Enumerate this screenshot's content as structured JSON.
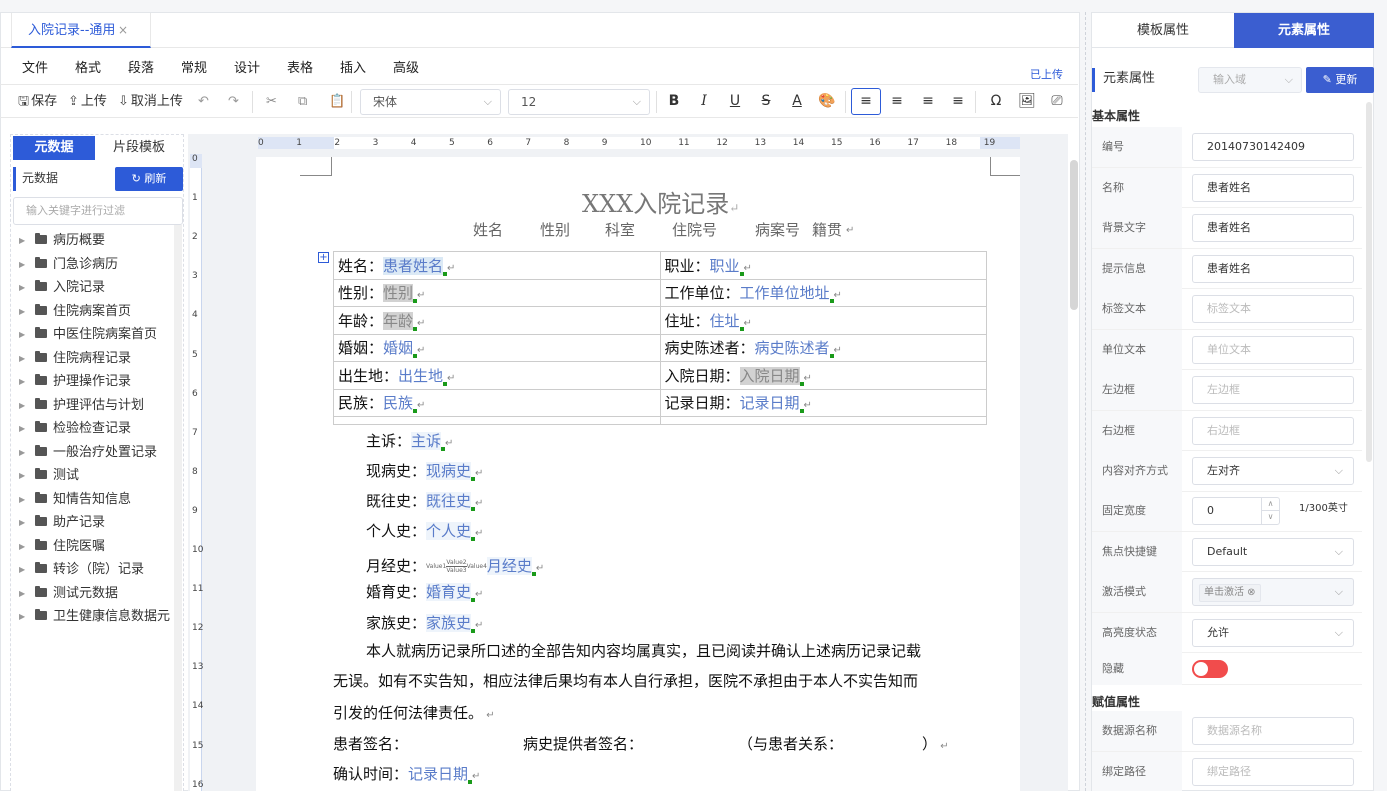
{
  "doc_tab": {
    "title": "入院记录--通用",
    "close": "×"
  },
  "menu": [
    "文件",
    "格式",
    "段落",
    "常规",
    "设计",
    "表格",
    "插入",
    "高级"
  ],
  "upload_status": "已上传",
  "toolbar": {
    "save": "保存",
    "upload": "上传",
    "cancel_upload": "取消上传",
    "font_family": "宋体",
    "font_size": "12"
  },
  "left_panel": {
    "tab_metadata": "元数据",
    "tab_fragment": "片段模板",
    "title": "元数据",
    "refresh": "刷新",
    "search_placeholder": "输入关键字进行过滤",
    "tree": [
      "病历概要",
      "门急诊病历",
      "入院记录",
      "住院病案首页",
      "中医住院病案首页",
      "住院病程记录",
      "护理操作记录",
      "护理评估与计划",
      "检验检查记录",
      "一般治疗处置记录",
      "测试",
      "知情告知信息",
      "助产记录",
      "住院医嘱",
      "转诊（院）记录",
      "测试元数据",
      "卫生健康信息数据元"
    ]
  },
  "ruler": {
    "h": [
      "0",
      "1",
      "2",
      "3",
      "4",
      "5",
      "6",
      "7",
      "8",
      "9",
      "10",
      "11",
      "12",
      "13",
      "14",
      "15",
      "16",
      "17",
      "18",
      "19"
    ],
    "v": [
      "0",
      "1",
      "2",
      "3",
      "4",
      "5",
      "6",
      "7",
      "8",
      "9",
      "10",
      "11",
      "12",
      "13",
      "14",
      "15",
      "16"
    ]
  },
  "document": {
    "title": "XXX入院记录",
    "subtitle": [
      "姓名",
      "性别",
      "科室",
      "住院号",
      "病案号",
      "籍贯"
    ],
    "table": [
      [
        {
          "label": "姓名：",
          "value": "患者姓名"
        },
        {
          "label": "职业：",
          "value": "职业"
        }
      ],
      [
        {
          "label": "性别：",
          "value": "性别"
        },
        {
          "label": "工作单位：",
          "value": "工作单位地址"
        }
      ],
      [
        {
          "label": "年龄：",
          "value": "年龄"
        },
        {
          "label": "住址：",
          "value": "住址"
        }
      ],
      [
        {
          "label": "婚姻：",
          "value": "婚姻"
        },
        {
          "label": "病史陈述者：",
          "value": "病史陈述者"
        }
      ],
      [
        {
          "label": "出生地：",
          "value": "出生地"
        },
        {
          "label": "入院日期：",
          "value": "入院日期"
        }
      ],
      [
        {
          "label": "民族：",
          "value": "民族"
        },
        {
          "label": "记录日期：",
          "value": "记录日期"
        }
      ]
    ],
    "lines": [
      {
        "label": "主诉：",
        "value": "主诉"
      },
      {
        "label": "现病史：",
        "value": "现病史"
      },
      {
        "label": "既往史：",
        "value": "既往史"
      },
      {
        "label": "个人史：",
        "value": "个人史"
      },
      {
        "label": "月经史：",
        "value": "月经史"
      },
      {
        "label": "婚育史：",
        "value": "婚育史"
      },
      {
        "label": "家族史：",
        "value": "家族史"
      }
    ],
    "menstrual_formula": {
      "left": "Value1",
      "top": "Value2",
      "bottom": "Value3",
      "right": "Value4"
    },
    "statement_1": "本人就病历记录所口述的全部告知内容均属真实，且已阅读并确认上述病历记录记载",
    "statement_2": "无误。如有不实告知，相应法律后果均有本人自行承担，医院不承担由于本人不实告知而",
    "statement_3": "引发的任何法律责任。",
    "sign_patient": "患者签名：",
    "sign_provider": "病史提供者签名：",
    "sign_relation": "（与患者关系：",
    "sign_relation_close": "）",
    "confirm_label": "确认时间：",
    "confirm_value": "记录日期"
  },
  "right_panel": {
    "tab_template": "模板属性",
    "tab_element": "元素属性",
    "title": "元素属性",
    "select_placeholder": "输入域",
    "update": "更新",
    "section_basic": "基本属性",
    "props": [
      {
        "label": "编号",
        "value": "20140730142409",
        "ph": false
      },
      {
        "label": "名称",
        "value": "患者姓名",
        "ph": false
      },
      {
        "label": "背景文字",
        "value": "患者姓名",
        "ph": false
      },
      {
        "label": "提示信息",
        "value": "患者姓名",
        "ph": false
      },
      {
        "label": "标签文本",
        "value": "标签文本",
        "ph": true
      },
      {
        "label": "单位文本",
        "value": "单位文本",
        "ph": true
      },
      {
        "label": "左边框",
        "value": "左边框",
        "ph": true
      },
      {
        "label": "右边框",
        "value": "右边框",
        "ph": true
      },
      {
        "label": "内容对齐方式",
        "value": "左对齐",
        "ph": false
      }
    ],
    "fixed_width_label": "固定宽度",
    "fixed_width_value": "0",
    "fixed_width_unit": "1/300英寸",
    "focus_label": "焦点快捷键",
    "focus_value": "Default",
    "activate_label": "激活模式",
    "activate_value": "单击激活",
    "highlight_label": "高亮度状态",
    "highlight_value": "允许",
    "hidden_label": "隐藏",
    "section_assign": "赋值属性",
    "datasource_label": "数据源名称",
    "datasource_ph": "数据源名称",
    "bindpath_label": "绑定路径",
    "bindpath_ph": "绑定路径"
  },
  "colors": {
    "accent": "#2d5bd8",
    "toggle_off": "#f14c4c",
    "field_text": "#5a7cc9"
  }
}
